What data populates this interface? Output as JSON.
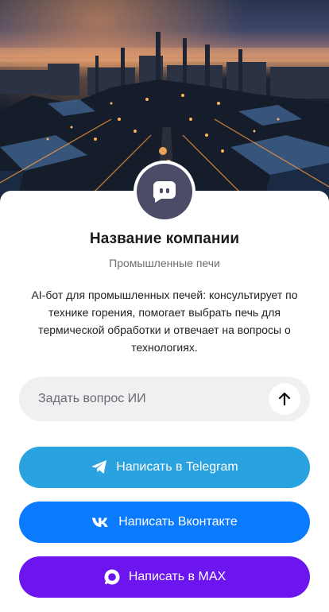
{
  "hero": {
    "image_description": "industrial-plant-night"
  },
  "company": {
    "name": "Название компании",
    "category": "Промышленные печи",
    "description": "AI-бот для промышленных печей: консультирует по технике горения, помогает выбрать печь для термической обработки и отвечает на вопросы о технологиях."
  },
  "search": {
    "placeholder": "Задать вопрос ИИ",
    "send_icon": "arrow-up-icon"
  },
  "buttons": {
    "telegram": {
      "label": "Написать в Telegram",
      "icon": "telegram-icon",
      "color": "#2ba2e0"
    },
    "vk": {
      "label": "Написать Вконтакте",
      "icon": "vk-icon",
      "color": "#0a7bff"
    },
    "max": {
      "label": "Написать в MAX",
      "icon": "max-icon",
      "color": "#6c15ef"
    }
  },
  "colors": {
    "avatar_bg": "#4b4d67",
    "search_bg": "#f0f0f2"
  }
}
